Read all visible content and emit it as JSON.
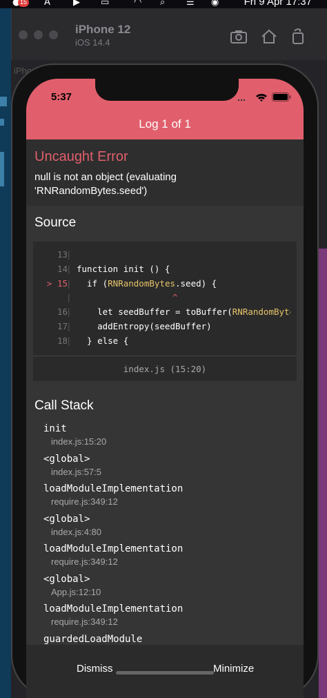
{
  "menubar": {
    "badge": "15",
    "clock": "Fri 9 Apr 17:37"
  },
  "simulator": {
    "device_name": "iPhone 12",
    "os_version": "iOS 14.4",
    "back_window_title": "iPhone 12"
  },
  "status_bar": {
    "time": "5:37"
  },
  "header": {
    "title": "Log 1 of 1"
  },
  "error": {
    "title": "Uncaught Error",
    "message": "null is not an object (evaluating 'RNRandomBytes.seed')"
  },
  "source": {
    "title": "Source",
    "lines": [
      {
        "num": "13",
        "pre": "",
        "hl": "",
        "post": "",
        "marker": ""
      },
      {
        "num": "14",
        "pre": "function init () {",
        "hl": "",
        "post": "",
        "marker": ""
      },
      {
        "num": "15",
        "pre": "  if (",
        "hl": "RNRandomBytes",
        "post": ".seed) {",
        "marker": ">"
      },
      {
        "num": "",
        "pre": "",
        "hl": "",
        "post": "",
        "marker": "",
        "caret": "^"
      },
      {
        "num": "16",
        "pre": "    let seedBuffer = toBuffer(",
        "hl": "RNRandomBytes",
        "post": "",
        "marker": ""
      },
      {
        "num": "17",
        "pre": "    addEntropy(seedBuffer)",
        "hl": "",
        "post": "",
        "marker": ""
      },
      {
        "num": "18",
        "pre": "  } else {",
        "hl": "",
        "post": "",
        "marker": ""
      }
    ],
    "file_ref": "index.js (15:20)"
  },
  "call_stack": {
    "title": "Call Stack",
    "frames": [
      {
        "fn": "init",
        "loc": "index.js:15:20"
      },
      {
        "fn": "<global>",
        "loc": "index.js:57:5"
      },
      {
        "fn": "loadModuleImplementation",
        "loc": "require.js:349:12"
      },
      {
        "fn": "<global>",
        "loc": "index.js:4:80"
      },
      {
        "fn": "loadModuleImplementation",
        "loc": "require.js:349:12"
      },
      {
        "fn": "<global>",
        "loc": "App.js:12:10"
      },
      {
        "fn": "loadModuleImplementation",
        "loc": "require.js:349:12"
      },
      {
        "fn": "guardedLoadModule",
        "loc": ""
      }
    ]
  },
  "footer": {
    "dismiss": "Dismiss",
    "minimize": "Minimize"
  }
}
